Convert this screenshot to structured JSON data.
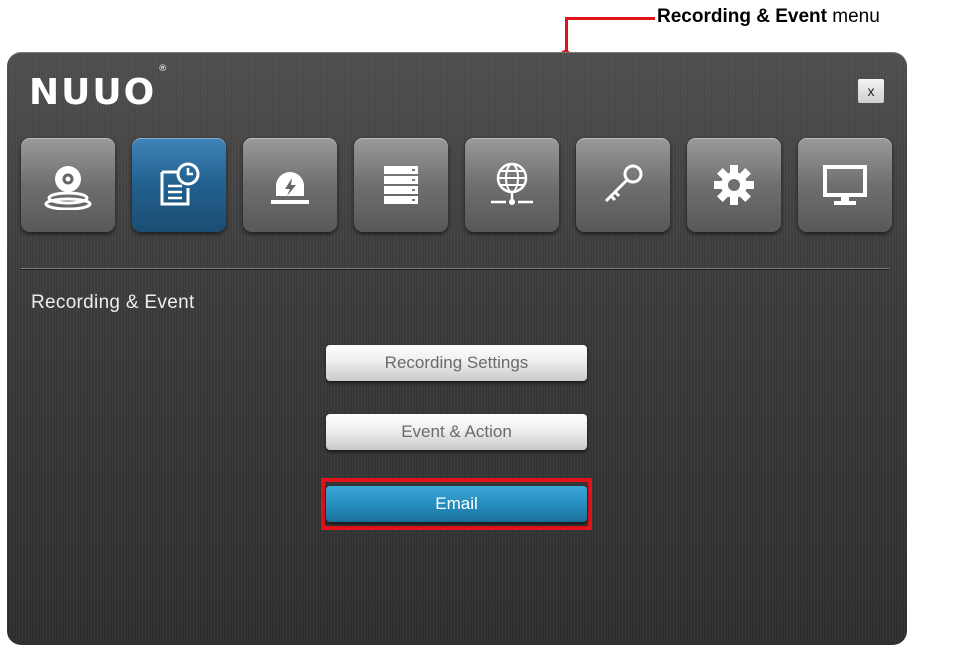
{
  "annotation": {
    "bold_text": "Recording & Event",
    "rest_text": " menu"
  },
  "window": {
    "logo": "NUUO",
    "logo_mark": "®",
    "close_label": "x"
  },
  "toolbar": {
    "items": [
      {
        "name": "camera",
        "icon": "webcam-icon",
        "active": false
      },
      {
        "name": "recording-event",
        "icon": "schedule-document-icon",
        "active": true
      },
      {
        "name": "alarm",
        "icon": "alarm-siren-icon",
        "active": false
      },
      {
        "name": "storage",
        "icon": "server-stack-icon",
        "active": false
      },
      {
        "name": "network",
        "icon": "network-globe-icon",
        "active": false
      },
      {
        "name": "security",
        "icon": "key-icon",
        "active": false
      },
      {
        "name": "settings",
        "icon": "gear-icon",
        "active": false
      },
      {
        "name": "display",
        "icon": "monitor-icon",
        "active": false
      }
    ]
  },
  "section": {
    "title": "Recording & Event"
  },
  "buttons": {
    "recording_settings": "Recording Settings",
    "event_action": "Event & Action",
    "email": "Email"
  },
  "colors": {
    "accent_blue": "#258bbd",
    "highlight_red": "#e0121a"
  }
}
